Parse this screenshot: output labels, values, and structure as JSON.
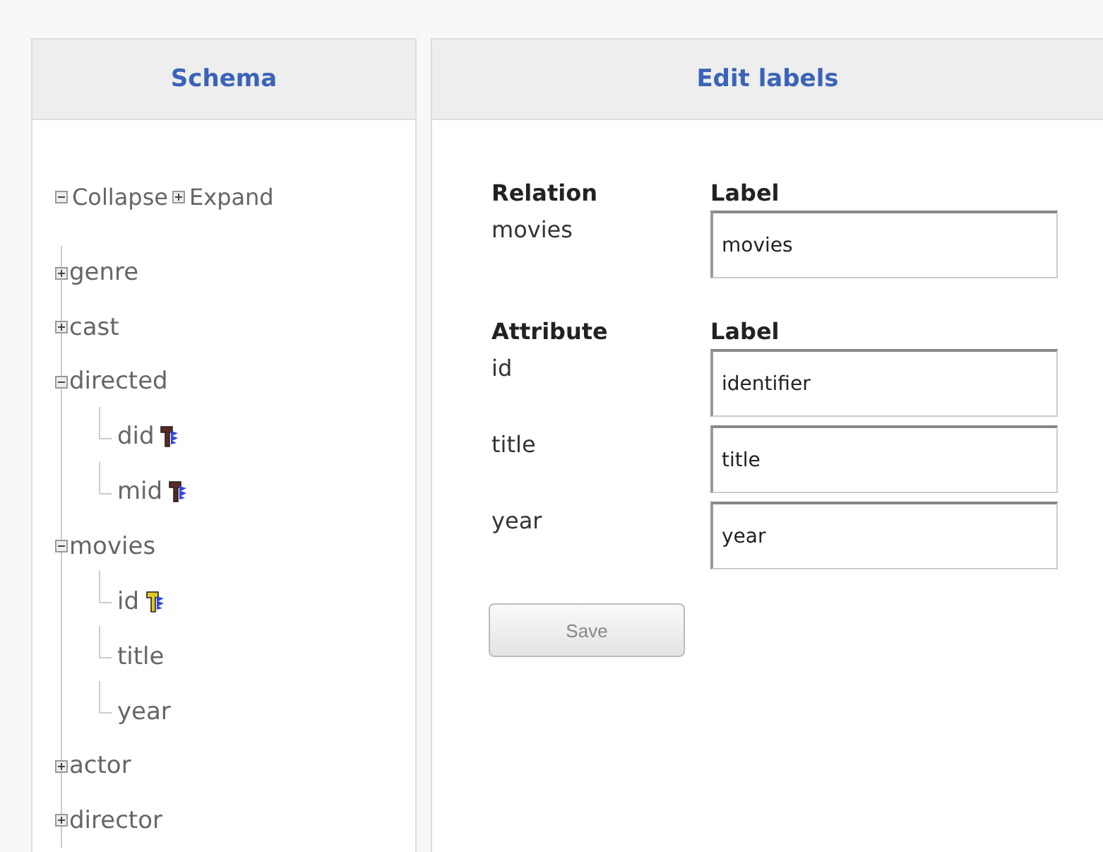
{
  "schema_panel": {
    "title": "Schema",
    "collapse_label": "Collapse",
    "expand_label": "Expand",
    "tree": [
      {
        "name": "genre",
        "expanded": false
      },
      {
        "name": "cast",
        "expanded": false
      },
      {
        "name": "directed",
        "expanded": true,
        "children": [
          {
            "name": "did",
            "kind": "foreign"
          },
          {
            "name": "mid",
            "kind": "foreign"
          }
        ]
      },
      {
        "name": "movies",
        "expanded": true,
        "children": [
          {
            "name": "id",
            "kind": "primary"
          },
          {
            "name": "title",
            "kind": "plain"
          },
          {
            "name": "year",
            "kind": "plain"
          }
        ]
      },
      {
        "name": "actor",
        "expanded": false
      },
      {
        "name": "director",
        "expanded": false
      }
    ]
  },
  "edit_panel": {
    "title": "Edit labels",
    "relation": {
      "heading": "Relation",
      "label_heading": "Label",
      "name": "movies",
      "value": "movies"
    },
    "attribute_heading": "Attribute",
    "attribute_label_heading": "Label",
    "attributes": [
      {
        "name": "id",
        "value": "identifier"
      },
      {
        "name": "title",
        "value": "title"
      },
      {
        "name": "year",
        "value": "year"
      }
    ],
    "save_button": "Save"
  }
}
